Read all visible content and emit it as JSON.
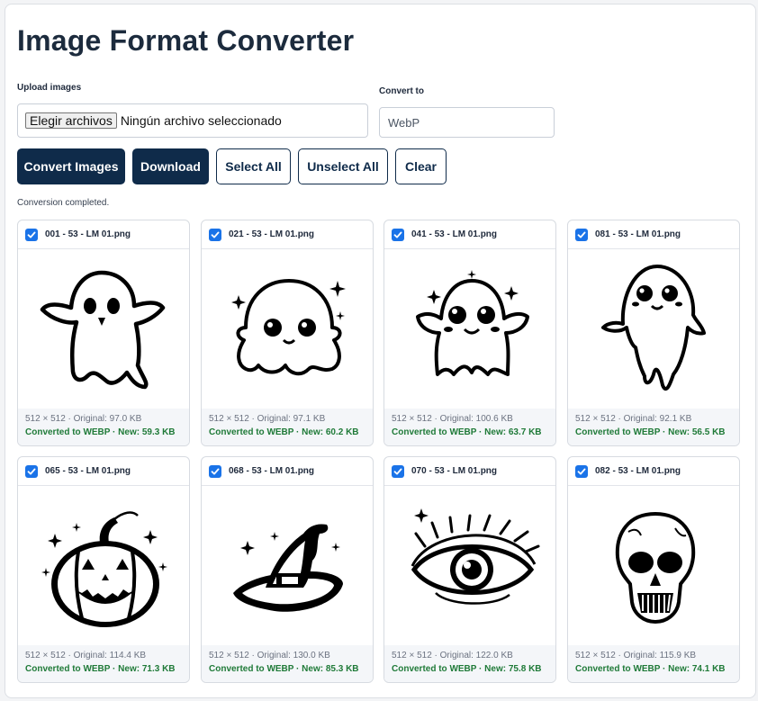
{
  "app": {
    "title": "Image Format Converter",
    "upload_label": "Upload images",
    "file_button": "Elegir archivos",
    "file_status": "Ningún archivo seleccionado",
    "convert_to_label": "Convert to",
    "format_value": "WebP"
  },
  "buttons": {
    "convert": "Convert Images",
    "download": "Download",
    "select_all": "Select All",
    "unselect_all": "Unselect All",
    "clear": "Clear"
  },
  "status": "Conversion completed.",
  "colors": {
    "primary": "#0f2b4a",
    "checkbox": "#1a73e8",
    "success": "#1f7a38"
  },
  "cards": [
    {
      "name": "001 - 53 - LM 01.png",
      "meta": "512 × 512 · Original: 97.0 KB",
      "converted": "Converted to WEBP · New: 59.3 KB",
      "icon": "ghost-icon",
      "checked": true
    },
    {
      "name": "021 - 53 - LM 01.png",
      "meta": "512 × 512 · Original: 97.1 KB",
      "converted": "Converted to WEBP · New: 60.2 KB",
      "icon": "cute-ghost-icon",
      "checked": true
    },
    {
      "name": "041 - 53 - LM 01.png",
      "meta": "512 × 512 · Original: 100.6 KB",
      "converted": "Converted to WEBP · New: 63.7 KB",
      "icon": "happy-ghost-icon",
      "checked": true
    },
    {
      "name": "081 - 53 - LM 01.png",
      "meta": "512 × 512 · Original: 92.1 KB",
      "converted": "Converted to WEBP · New: 56.5 KB",
      "icon": "tall-ghost-icon",
      "checked": true
    },
    {
      "name": "065 - 53 - LM 01.png",
      "meta": "512 × 512 · Original: 114.4 KB",
      "converted": "Converted to WEBP · New: 71.3 KB",
      "icon": "pumpkin-icon",
      "checked": true
    },
    {
      "name": "068 - 53 - LM 01.png",
      "meta": "512 × 512 · Original: 130.0 KB",
      "converted": "Converted to WEBP · New: 85.3 KB",
      "icon": "witch-hat-icon",
      "checked": true
    },
    {
      "name": "070 - 53 - LM 01.png",
      "meta": "512 × 512 · Original: 122.0 KB",
      "converted": "Converted to WEBP · New: 75.8 KB",
      "icon": "eye-icon",
      "checked": true
    },
    {
      "name": "082 - 53 - LM 01.png",
      "meta": "512 × 512 · Original: 115.9 KB",
      "converted": "Converted to WEBP · New: 74.1 KB",
      "icon": "skull-icon",
      "checked": true
    }
  ]
}
